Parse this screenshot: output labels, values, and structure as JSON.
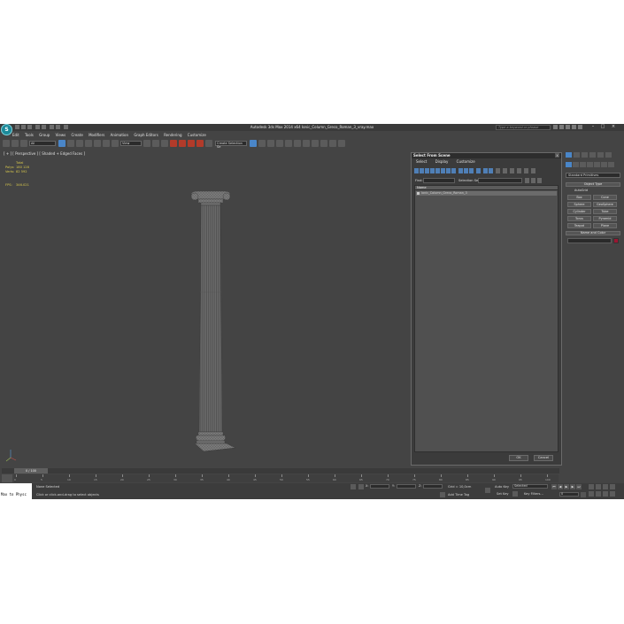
{
  "app": {
    "window_title": "Autodesk 3ds Max 2014 x64    Ionic_Column_Greco_Roman_3_vray.max",
    "search_placeholder": "Type a keyword or phrase",
    "logo_text": "S",
    "menu": [
      "Edit",
      "Tools",
      "Group",
      "Views",
      "Create",
      "Modifiers",
      "Animation",
      "Graph Editors",
      "Rendering",
      "Customize",
      "MAXScript",
      "Help"
    ]
  },
  "toolbar": {
    "selection_filter": "All",
    "reference_coord": "View",
    "named_selection": "Create Selection Se"
  },
  "viewport": {
    "label": "[ + ] [ Perspective ] [ Shaded + Edged Faces ]",
    "stats": {
      "header": "Total",
      "polys_label": "Polys:",
      "polys_value": "180 128",
      "verts_label": "Verts:",
      "verts_value": "82 592",
      "fps_label": "FPS:",
      "fps_value": "346.021"
    }
  },
  "dialog": {
    "title": "Select From Scene",
    "close": "x",
    "tabs": [
      "Select",
      "Display",
      "Customize"
    ],
    "find_label": "Find:",
    "selection_set_label": "Selection Set:",
    "column_header": "Name",
    "rows": [
      "Ionic_Column_Greco_Roman_3"
    ],
    "ok": "OK",
    "cancel": "Cancel"
  },
  "command_panel": {
    "category": "Standard Primitives",
    "object_type_header": "Object Type",
    "autogrid": "AutoGrid",
    "primitives": [
      "Box",
      "Cone",
      "Sphere",
      "GeoSphere",
      "Cylinder",
      "Tube",
      "Torus",
      "Pyramid",
      "Teapot",
      "Plane"
    ],
    "name_color_header": "Name and Color",
    "color": "#9a1732"
  },
  "timeline": {
    "slider": "0 / 100",
    "ticks": [
      "0",
      "5",
      "10",
      "15",
      "20",
      "25",
      "30",
      "35",
      "40",
      "45",
      "50",
      "55",
      "60",
      "65",
      "70",
      "75",
      "80",
      "85",
      "90",
      "95",
      "100"
    ]
  },
  "status": {
    "maxscript": "Max to Physc",
    "selection": "None Selected",
    "prompt": "Click or click-and-drag to select objects",
    "x_label": "X:",
    "y_label": "Y:",
    "z_label": "Z:",
    "grid": "Grid = 10,0cm",
    "add_time_tag": "Add Time Tag",
    "auto_key": "Auto Key",
    "selected": "Selected",
    "set_key": "Set Key",
    "key_filters": "Key Filters...",
    "frame": "0"
  }
}
